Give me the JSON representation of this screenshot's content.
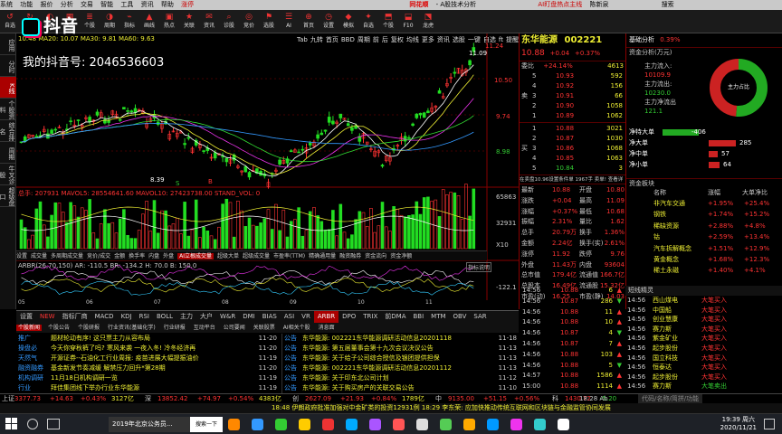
{
  "titlebar": {
    "items": [
      "系统",
      "功能",
      "报价",
      "分析",
      "交易",
      "智能",
      "工具",
      "资讯",
      "帮助",
      "涨停",
      "同花顺",
      "- A股技术分析"
    ],
    "right": [
      "AI盯盘热点主线",
      "陈新泉",
      "...",
      "搜索"
    ]
  },
  "toolbar": {
    "buttons": [
      [
        "↺",
        "自选"
      ],
      [
        "↻",
        "板块"
      ],
      [
        "◐",
        "综合"
      ],
      [
        "▦",
        "多股"
      ],
      [
        "≣",
        "个股"
      ],
      [
        "◑",
        "周期"
      ],
      [
        "⌁",
        "指标"
      ],
      [
        "▲",
        "画线"
      ],
      [
        "▣",
        "热点"
      ],
      [
        "★",
        "关联"
      ],
      [
        "✉",
        "资讯"
      ],
      [
        "⌕",
        "诊股"
      ],
      [
        "◎",
        "竞价"
      ],
      [
        "⚑",
        "选股"
      ],
      [
        "☰",
        "AI"
      ],
      [
        "⊕",
        "首页"
      ],
      [
        "◷",
        "设置"
      ],
      [
        "◆",
        "模拟"
      ],
      [
        "✦",
        "自选"
      ],
      [
        "⬒",
        "个股"
      ],
      [
        "⬓",
        "F10"
      ],
      [
        "⬔",
        "龙虎"
      ]
    ],
    "labels": [
      "Tab",
      "九转",
      "首页",
      "BBD",
      "周期",
      "前",
      "后",
      "复权",
      "均线",
      "更多",
      "资讯",
      "选股",
      "一键",
      "自选",
      "ft",
      "提醒",
      "放大",
      "下单"
    ]
  },
  "watermark": {
    "logo": "抖音",
    "account": "我的抖音号: 2046536603"
  },
  "leftbar": [
    "应用",
    "分时",
    "K线",
    "个股资料",
    "综合排名",
    "周期",
    "牛叉诊股",
    "超级盘口"
  ],
  "chart": {
    "ma_header": "10.48  MA20: 10.07  MA30: 9.81  MA60: 9.63",
    "ma_labels": [
      "MA5",
      "MA10",
      "MA20",
      "MA30",
      "MA60"
    ],
    "high": "11.09",
    "low": "8.39",
    "s_label": "S",
    "b_label": "B",
    "axis_main": [
      "11.24",
      "10.50",
      "9.74",
      "8.98"
    ],
    "vol_header": "总手: 207931  MAVOL5: 28554641.60  MAVOL10: 27423738.00  STAND_VOL: 0",
    "axis_vol": [
      "65863",
      "32931",
      "X10"
    ],
    "sub_tabs": [
      "设置",
      "成交量",
      "多周期成交量",
      "竞价/成交",
      "金额",
      "换手率",
      "内盘",
      "外盘",
      "AI立根成交量",
      "超级大单",
      "超级成交量",
      "市盈率(TTM)",
      "精确通用量",
      "融资融券",
      "资金流向",
      "资金净额"
    ],
    "arbr_header": "ARBR(26,70,150)  AR: -110.5  BR: -134.2  H: 70.0  B: 150.0",
    "arbr_tag": "指标说明",
    "axis_arbr": [
      "-122.1"
    ],
    "dates": [
      "05",
      "06",
      "07",
      "08",
      "09",
      "10",
      "11"
    ],
    "indicator_tabs": [
      "设置",
      "NEW",
      "指标厂商",
      "MACD",
      "KDJ",
      "RSI",
      "BOLL",
      "主力",
      "大户",
      "W&R",
      "DMI",
      "BIAS",
      "ASI",
      "VR",
      "ARBR",
      "DPO",
      "TRIX",
      "前DMA",
      "BBI",
      "MTM",
      "OBV",
      "SAR",
      "EXPMA"
    ]
  },
  "chart_data": {
    "type": "candlestick",
    "title": "东华能源 002221",
    "high": 11.09,
    "low": 8.39,
    "ylim": [
      8.39,
      11.24
    ]
  },
  "quote": {
    "name": "东华能源",
    "code": "002221",
    "price": "10.88",
    "change": "+0.04",
    "pct": "+0.37%",
    "wb_label": "委比",
    "wb": "+24.14%",
    "wb_num": "4613",
    "sell": [
      [
        "5",
        "10.93",
        "592"
      ],
      [
        "4",
        "10.92",
        "156"
      ],
      [
        "3",
        "10.91",
        "66"
      ],
      [
        "2",
        "10.90",
        "1058"
      ],
      [
        "1",
        "10.89",
        "1062"
      ]
    ],
    "buy": [
      [
        "1",
        "10.88",
        "3021"
      ],
      [
        "2",
        "10.87",
        "1030"
      ],
      [
        "3",
        "10.86",
        "1068"
      ],
      [
        "4",
        "10.85",
        "1063"
      ],
      [
        "5",
        "10.84",
        "3"
      ]
    ],
    "hint": "在卖盘10.96设置条件单  1967手  卖单!  查看详细",
    "stats": [
      [
        "最新",
        "10.88",
        "开盘",
        "10.80"
      ],
      [
        "涨跌",
        "+0.04",
        "最高",
        "11.09"
      ],
      [
        "涨幅",
        "+0.37%",
        "最低",
        "10.68"
      ],
      [
        "振幅",
        "2.31%",
        "量比",
        "1.62"
      ],
      [
        "总手",
        "20.79万",
        "换手",
        "1.36%"
      ],
      [
        "金额",
        "2.24亿",
        "换手(实)",
        "2.61%"
      ],
      [
        "涨停",
        "11.92",
        "跌停",
        "9.76"
      ],
      [
        "外盘",
        "11.43万",
        "内盘",
        "93604"
      ],
      [
        "总市值",
        "179.4亿",
        "流通值",
        "166.7亿"
      ],
      [
        "总股本",
        "16.49亿",
        "流通股",
        "15.32亿"
      ],
      [
        "市盈(动)",
        "16.25",
        "市盈(静)",
        "14.03"
      ]
    ]
  },
  "side": {
    "tabs": [
      "基础分析",
      "0.39%"
    ],
    "fund_title": "资金分析(万元)",
    "flows": [
      [
        "主力流入:",
        "10109.9"
      ],
      [
        "主力流出:",
        "10230.0"
      ],
      [
        "主力净流出",
        "121.1"
      ]
    ],
    "pie_center": "主力占比",
    "net": [
      [
        "净特大单",
        "-406"
      ],
      [
        "净大单",
        "285"
      ],
      [
        "净中单",
        "57"
      ],
      [
        "净小单",
        "64"
      ]
    ],
    "sector_title": "资金板块",
    "sector_headers": [
      "名称",
      "涨幅",
      "大单净比"
    ],
    "sectors": [
      [
        "非汽车交通",
        "+1.95%",
        "+25.4%"
      ],
      [
        "钢铁",
        "+1.74%",
        "+15.2%"
      ],
      [
        "稀缺资源",
        "+2.88%",
        "+4.8%"
      ],
      [
        "钴",
        "+2.59%",
        "+13.4%"
      ],
      [
        "汽车拆解概念",
        "+1.51%",
        "+12.9%"
      ],
      [
        "黄金概念",
        "+1.68%",
        "+12.3%"
      ],
      [
        "稀土永磁",
        "+1.40%",
        "+4.1%"
      ]
    ],
    "alert_title": "短线精灵"
  },
  "ticks": [
    [
      "14:56",
      "10.88",
      "6"
    ],
    [
      "14:56",
      "10.87",
      "286"
    ],
    [
      "14:56",
      "10.88",
      "11"
    ],
    [
      "14:56",
      "10.88",
      "10"
    ],
    [
      "14:56",
      "10.87",
      "4"
    ],
    [
      "14:56",
      "10.87",
      "7"
    ],
    [
      "14:56",
      "10.88",
      "103"
    ],
    [
      "14:56",
      "10.88",
      "5"
    ],
    [
      "14:57",
      "10.88",
      "1586"
    ],
    [
      "15:00",
      "10.88",
      "1114"
    ]
  ],
  "alerts": [
    [
      "14:56",
      "西山煤电",
      "大笔买入"
    ],
    [
      "14:56",
      "中国船",
      "大笔买入"
    ],
    [
      "14:56",
      "创业慧康",
      "大笔买入"
    ],
    [
      "14:56",
      "赛力斯",
      "大笔买入"
    ],
    [
      "14:56",
      "紫金矿业",
      "大笔买入"
    ],
    [
      "14:56",
      "起步股份",
      "大笔买入"
    ],
    [
      "14:56",
      "国立科技",
      "大笔买入"
    ],
    [
      "14:56",
      "恒泰达",
      "大笔买入"
    ],
    [
      "14:56",
      "起步股份",
      "大笔买入"
    ],
    [
      "14:56",
      "赛力斯",
      "大笔卖出"
    ]
  ],
  "tabs_news": [
    "个股新闻",
    "个股公告",
    "个股研报",
    "行业资讯(基础化学)",
    "行业研报",
    "互动平台",
    "公司要闻",
    "关联股票",
    "AI相关个股",
    "消息面"
  ],
  "news_left": [
    [
      "推广",
      "题材轮动有序! 这只票主力从容布局",
      "11-20"
    ],
    [
      "操盘必",
      "今天你穿秋裤了吗? 寒风来袭 一夜入冬! 冷冬经济再",
      "11-20"
    ],
    [
      "天然气",
      "开源证券--石油化工行业周报: 疫苗进展大幅提振油价",
      "11-19"
    ],
    [
      "融资融券",
      "基金新发节奏减缓 解禁压力回升*第28期",
      "11-20"
    ],
    [
      "机构调研",
      "11月18日机构调研一览",
      "11-19"
    ],
    [
      "行业",
      "拜佳集团线下举办行业东华能源",
      "11-19"
    ]
  ],
  "news_right": [
    [
      "公告",
      "东华能源: 002221东华能源调研活动信息20201118",
      "11-18"
    ],
    [
      "公告",
      "东华能源: 第五届董事会第十九次会议决议公告",
      "11-13"
    ],
    [
      "公告",
      "东华能源: 关于给子公司综合授信及银团提供担保",
      "11-13"
    ],
    [
      "公告",
      "东华能源: 002221东华能源调研活动信息20201112",
      "11-13"
    ],
    [
      "公告",
      "东华能源: 关于印东北公司计划",
      "11-12"
    ],
    [
      "公告",
      "东华能源: 关于购买房产的关联交易公告",
      "11-10"
    ]
  ],
  "status": {
    "items": [
      [
        "上证",
        "3377.73",
        "+14.63",
        "+0.43%",
        "3127亿"
      ],
      [
        "深",
        "13852.42",
        "+74.97",
        "+0.54%",
        "4383亿"
      ],
      [
        "创",
        "2627.09",
        "+21.93",
        "+0.84%",
        "1789亿"
      ],
      [
        "中",
        "9135.00",
        "+51.15",
        "+0.56%",
        ""
      ],
      [
        "科",
        "1430.72",
        "-5.20",
        "",
        ""
      ]
    ],
    "time": "18:28 Ab",
    "right": "代码/名称/简拼/功能"
  },
  "status2": "18:48 伊朗政府批准加强对中金矿类的投资12931例    18:29 李东荣: 应加快推动传统互联网和区块链与金融监管协同发展",
  "taskbar": {
    "apps": [
      "2019年北京公务员...",
      "搜索一下"
    ],
    "time": "19:39 周六",
    "date": "2020/11/21"
  }
}
